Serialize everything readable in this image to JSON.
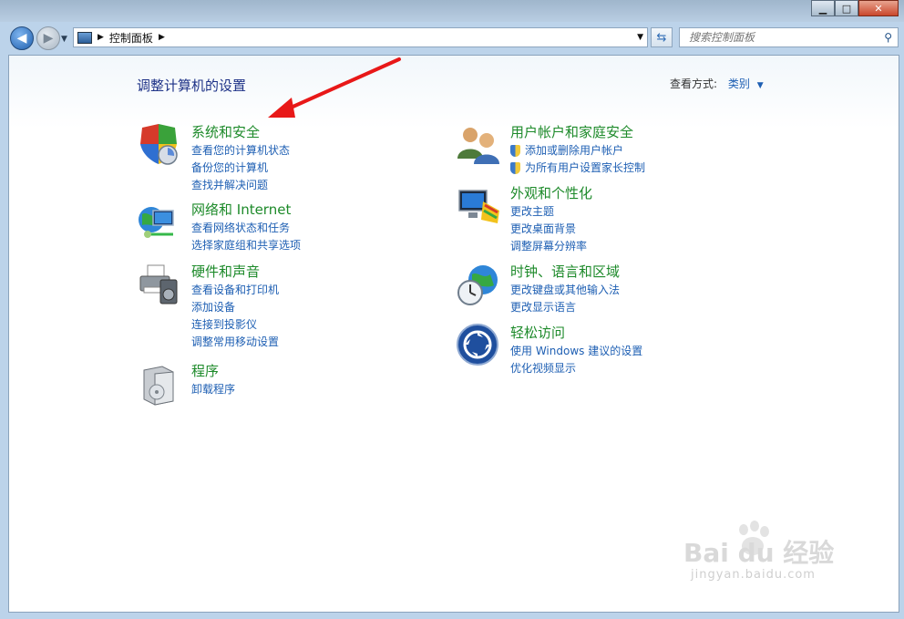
{
  "address": {
    "breadcrumb": "控制面板",
    "search_placeholder": "搜索控制面板"
  },
  "main": {
    "heading": "调整计算机的设置",
    "view_by_label": "查看方式:",
    "view_by_value": "类别"
  },
  "categories_left": [
    {
      "title": "系统和安全",
      "links": [
        "查看您的计算机状态",
        "备份您的计算机",
        "查找并解决问题"
      ]
    },
    {
      "title": "网络和 Internet",
      "links": [
        "查看网络状态和任务",
        "选择家庭组和共享选项"
      ]
    },
    {
      "title": "硬件和声音",
      "links": [
        "查看设备和打印机",
        "添加设备",
        "连接到投影仪",
        "调整常用移动设置"
      ]
    },
    {
      "title": "程序",
      "links": [
        "卸载程序"
      ]
    }
  ],
  "categories_right": [
    {
      "title": "用户帐户和家庭安全",
      "links": [
        "添加或删除用户帐户",
        "为所有用户设置家长控制"
      ]
    },
    {
      "title": "外观和个性化",
      "links": [
        "更改主题",
        "更改桌面背景",
        "调整屏幕分辨率"
      ]
    },
    {
      "title": "时钟、语言和区域",
      "links": [
        "更改键盘或其他输入法",
        "更改显示语言"
      ]
    },
    {
      "title": "轻松访问",
      "links": [
        "使用 Windows 建议的设置",
        "优化视频显示"
      ]
    }
  ],
  "watermark": {
    "brand": "Bai  du 经验",
    "url": "jingyan.baidu.com"
  },
  "colors": {
    "link": "#1e5fb3",
    "category_title": "#1d8a2a",
    "heading": "#1e3287",
    "annotation_arrow": "#e81818"
  },
  "icons": {
    "system": "shield-icon",
    "network": "globe-network-icon",
    "hardware": "printer-icon",
    "programs": "software-box-icon",
    "users": "users-icon",
    "appearance": "monitor-paint-icon",
    "clock": "globe-clock-icon",
    "access": "ease-of-access-icon"
  }
}
